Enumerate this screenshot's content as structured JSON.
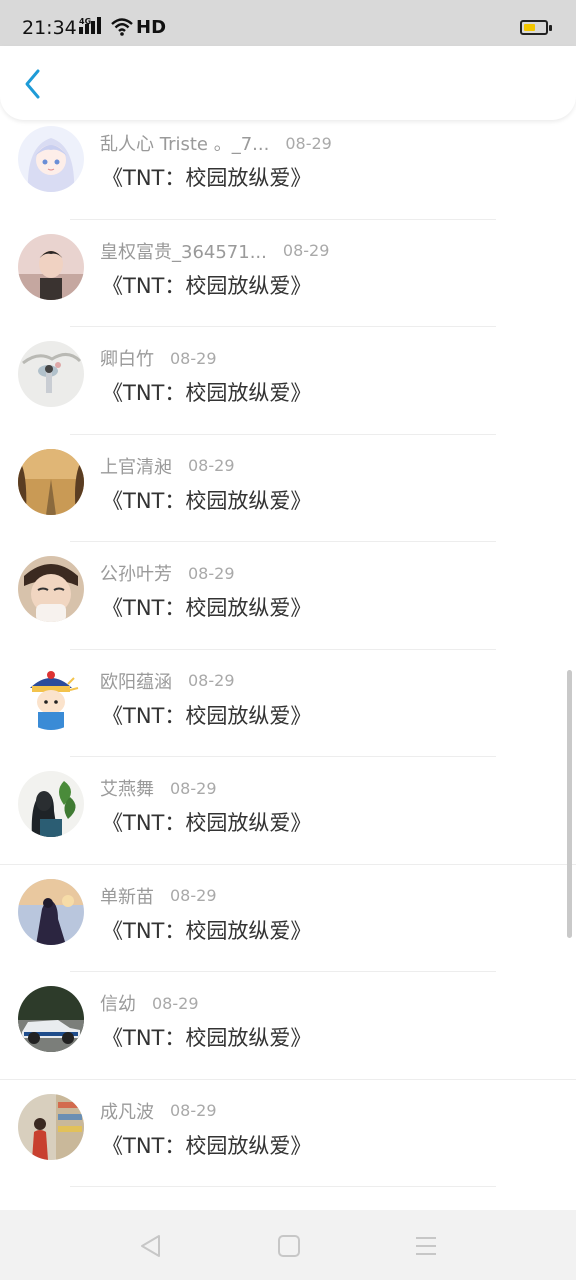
{
  "status_bar": {
    "time": "21:34",
    "network": "4G",
    "wifi_label": "HD",
    "battery_level": 0.55,
    "battery_color": "#f2c600"
  },
  "header": {
    "back_icon": "chevron-left-icon",
    "accent_color": "#1e9bd7"
  },
  "list": {
    "items": [
      {
        "name": "乱人心 Triste 。_7...",
        "date": "08-29",
        "title": "《TNT：校园放纵爱》",
        "avatar": "anime-girl"
      },
      {
        "name": "皇权富贵_364571...",
        "date": "08-29",
        "title": "《TNT：校园放纵爱》",
        "avatar": "boy-portrait"
      },
      {
        "name": "卿白竹",
        "date": "08-29",
        "title": "《TNT：校园放纵爱》",
        "avatar": "ink-painting"
      },
      {
        "name": "上官清昶",
        "date": "08-29",
        "title": "《TNT：校园放纵爱》",
        "avatar": "autumn-road"
      },
      {
        "name": "公孙叶芳",
        "date": "08-29",
        "title": "《TNT：校园放纵爱》",
        "avatar": "boy-face"
      },
      {
        "name": "欧阳蕴涵",
        "date": "08-29",
        "title": "《TNT：校园放纵爱》",
        "avatar": "cartoon-official"
      },
      {
        "name": "艾燕舞",
        "date": "08-29",
        "title": "《TNT：校园放纵爱》",
        "avatar": "girl-with-plant"
      },
      {
        "name": "单新苗",
        "date": "08-29",
        "title": "《TNT：校园放纵爱》",
        "avatar": "figure-at-sunset"
      },
      {
        "name": "信幼",
        "date": "08-29",
        "title": "《TNT：校园放纵爱》",
        "avatar": "vintage-car"
      },
      {
        "name": "成凡波",
        "date": "08-29",
        "title": "《TNT：校园放纵爱》",
        "avatar": "shop-scene"
      }
    ]
  },
  "nav_bar": {
    "back": "nav-back-icon",
    "home": "nav-home-icon",
    "menu": "nav-menu-icon"
  }
}
